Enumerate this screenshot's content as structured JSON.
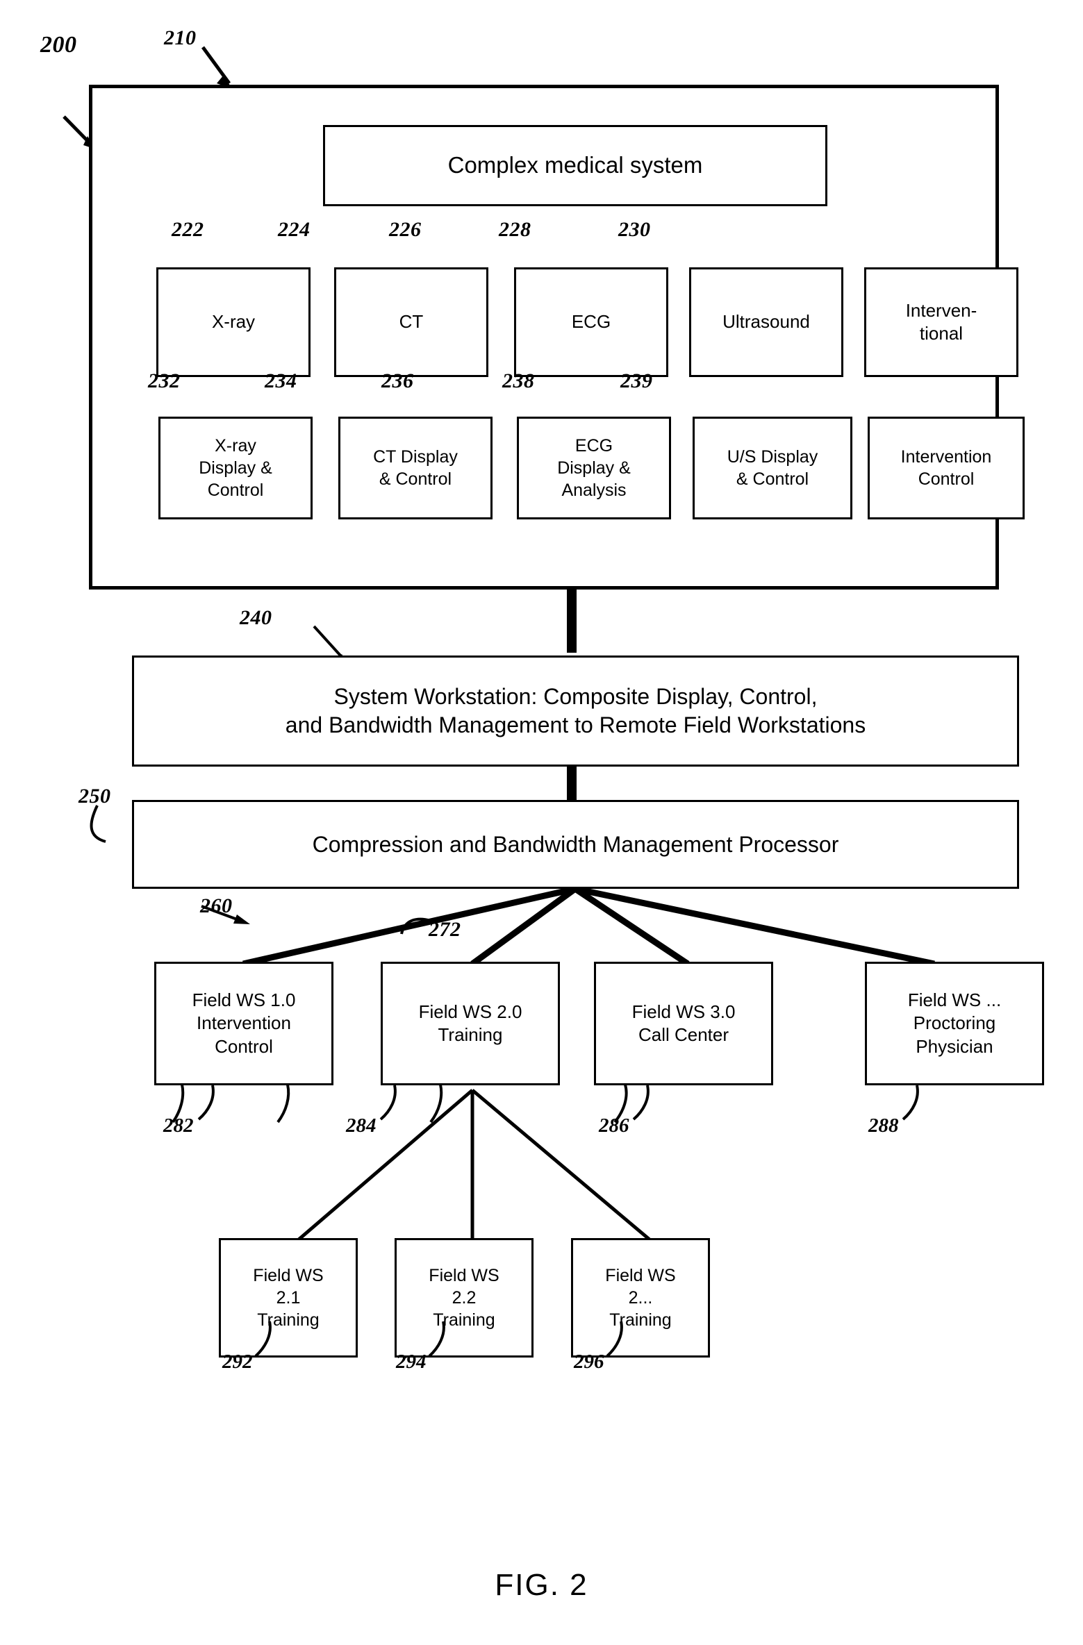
{
  "figure": {
    "caption": "FIG. 2",
    "diagram_ref": "200",
    "system_ref": "210"
  },
  "system": {
    "title": "Complex medical system",
    "modalities": [
      {
        "ref": "222",
        "label": "X-ray"
      },
      {
        "ref": "224",
        "label": "CT"
      },
      {
        "ref": "226",
        "label": "ECG"
      },
      {
        "ref": "228",
        "label": "Ultrasound"
      },
      {
        "ref": "230",
        "label": "Interven-\ntional"
      }
    ],
    "displays": [
      {
        "ref": "232",
        "label": "X-ray\nDisplay &\nControl"
      },
      {
        "ref": "234",
        "label": "CT Display\n& Control"
      },
      {
        "ref": "236",
        "label": "ECG\nDisplay &\nAnalysis"
      },
      {
        "ref": "238",
        "label": "U/S Display\n& Control"
      },
      {
        "ref": "239",
        "label": "Intervention\nControl"
      }
    ]
  },
  "workstation": {
    "ref": "240",
    "label": "System Workstation: Composite Display, Control,\nand Bandwidth Management to Remote Field Workstations"
  },
  "compression": {
    "ref": "250",
    "label": "Compression and Bandwidth Management Processor"
  },
  "network": {
    "ref": "260",
    "link_ref": "272"
  },
  "field_workstations": [
    {
      "ref": "282",
      "label": "Field WS 1.0\nIntervention\nControl"
    },
    {
      "ref": "284",
      "label": "Field WS 2.0\nTraining"
    },
    {
      "ref": "286",
      "label": "Field WS 3.0\nCall Center"
    },
    {
      "ref": "288",
      "label": "Field WS ...\nProctoring\nPhysician"
    }
  ],
  "sub_workstations": [
    {
      "ref": "292",
      "label": "Field WS\n2.1\nTraining"
    },
    {
      "ref": "294",
      "label": "Field WS\n2.2\nTraining"
    },
    {
      "ref": "296",
      "label": "Field WS\n2...\nTraining"
    }
  ],
  "colors": {
    "ink": "#000000",
    "paper": "#ffffff"
  }
}
